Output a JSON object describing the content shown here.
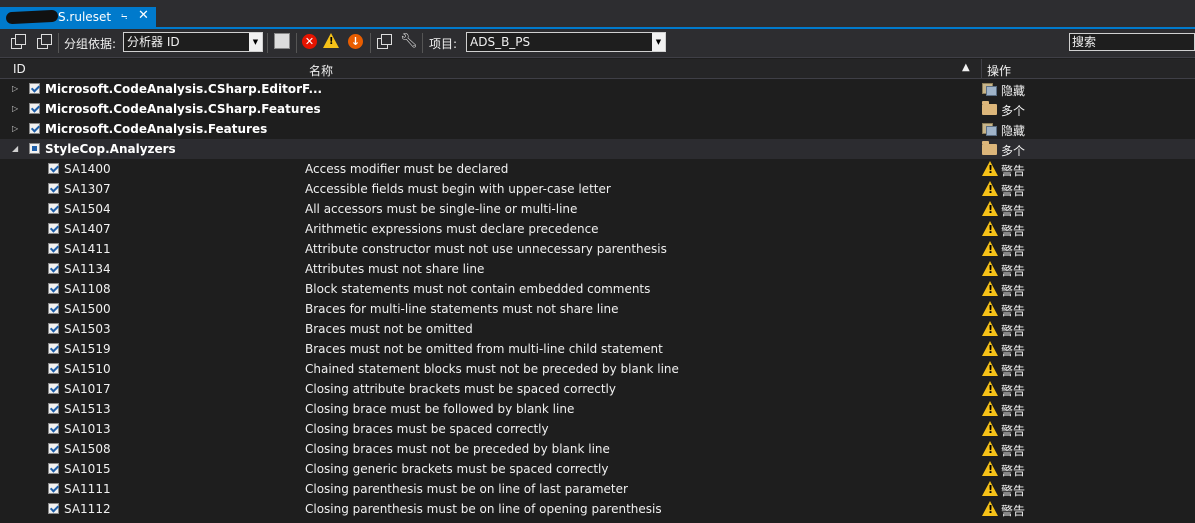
{
  "tab": {
    "title": "S.ruleset",
    "pin": "⨫",
    "close": "✕"
  },
  "toolbar": {
    "group_by_label": "分组依据:",
    "group_by_value": "分析器 ID",
    "project_label": "项目:",
    "project_value": "ADS_B_PS",
    "search_placeholder": "搜索",
    "error_glyph": "✕",
    "warning_glyph": "!",
    "info_glyph": "↓"
  },
  "header": {
    "id": "ID",
    "name": "名称",
    "action": "操作",
    "sort_glyph": "▲"
  },
  "colors": {
    "accent": "#007acc",
    "warning": "#f6c218",
    "error": "#e51400",
    "info": "#e85d00"
  },
  "groups": [
    {
      "name": "Microsoft.CodeAnalysis.CSharp.EditorF...",
      "action": "隐藏",
      "icon": "hidden-icon"
    },
    {
      "name": "Microsoft.CodeAnalysis.CSharp.Features",
      "action": "多个",
      "icon": "folder-icon"
    },
    {
      "name": "Microsoft.CodeAnalysis.Features",
      "action": "隐藏",
      "icon": "hidden-icon"
    },
    {
      "name": "StyleCop.Analyzers",
      "action": "多个",
      "icon": "folder-icon"
    }
  ],
  "rules": [
    {
      "id": "SA1400",
      "name": "Access modifier must be declared",
      "action": "警告"
    },
    {
      "id": "SA1307",
      "name": "Accessible fields must begin with upper-case letter",
      "action": "警告"
    },
    {
      "id": "SA1504",
      "name": "All accessors must be single-line or multi-line",
      "action": "警告"
    },
    {
      "id": "SA1407",
      "name": "Arithmetic expressions must declare precedence",
      "action": "警告"
    },
    {
      "id": "SA1411",
      "name": "Attribute constructor must not use unnecessary parenthesis",
      "action": "警告"
    },
    {
      "id": "SA1134",
      "name": "Attributes must not share line",
      "action": "警告"
    },
    {
      "id": "SA1108",
      "name": "Block statements must not contain embedded comments",
      "action": "警告"
    },
    {
      "id": "SA1500",
      "name": "Braces for multi-line statements must not share line",
      "action": "警告"
    },
    {
      "id": "SA1503",
      "name": "Braces must not be omitted",
      "action": "警告"
    },
    {
      "id": "SA1519",
      "name": "Braces must not be omitted from multi-line child statement",
      "action": "警告"
    },
    {
      "id": "SA1510",
      "name": "Chained statement blocks must not be preceded by blank line",
      "action": "警告"
    },
    {
      "id": "SA1017",
      "name": "Closing attribute brackets must be spaced correctly",
      "action": "警告"
    },
    {
      "id": "SA1513",
      "name": "Closing brace must be followed by blank line",
      "action": "警告"
    },
    {
      "id": "SA1013",
      "name": "Closing braces must be spaced correctly",
      "action": "警告"
    },
    {
      "id": "SA1508",
      "name": "Closing braces must not be preceded by blank line",
      "action": "警告"
    },
    {
      "id": "SA1015",
      "name": "Closing generic brackets must be spaced correctly",
      "action": "警告"
    },
    {
      "id": "SA1111",
      "name": "Closing parenthesis must be on line of last parameter",
      "action": "警告"
    },
    {
      "id": "SA1112",
      "name": "Closing parenthesis must be on line of opening parenthesis",
      "action": "警告"
    }
  ]
}
